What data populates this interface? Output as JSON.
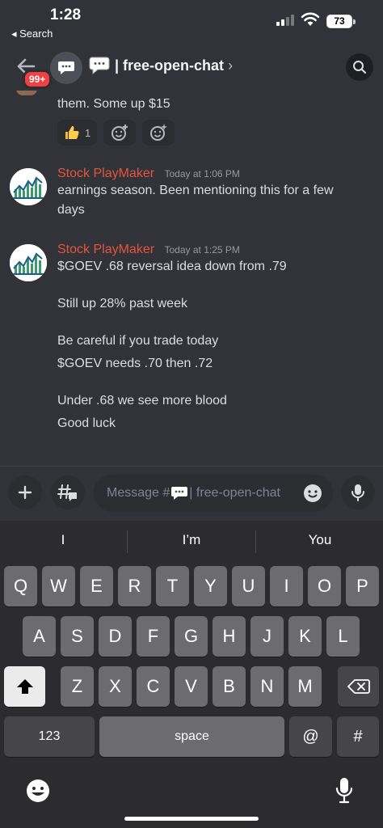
{
  "status_bar": {
    "time": "1:28",
    "back_app": "◂ Search",
    "battery": "73"
  },
  "header": {
    "badge": "99+",
    "channel_name": "| free-open-chat",
    "chevron": "›"
  },
  "messages": {
    "partial_text": "them. Some up $15",
    "reactions": [
      {
        "emoji": "thumbs-up",
        "count": "1"
      },
      {
        "emoji": "add-reaction-icon",
        "count": ""
      },
      {
        "emoji": "add-super-reaction-icon",
        "count": ""
      }
    ],
    "items": [
      {
        "author": "Stock PlayMaker",
        "timestamp": "Today at 1:06 PM",
        "lines": [
          "earnings season. Been mentioning this for a few",
          "days"
        ]
      },
      {
        "author": "Stock PlayMaker",
        "timestamp": "Today at 1:25 PM",
        "lines": [
          "$GOEV .68 reversal idea down from .79",
          "Still up 28% past week",
          "Be careful if you trade today",
          "$GOEV needs .70 then .72",
          "Under .68 we see more blood",
          "Good luck"
        ]
      }
    ]
  },
  "composer": {
    "placeholder_prefix": "Message #",
    "placeholder_suffix": " | free-open-chat"
  },
  "keyboard": {
    "suggestions": [
      "I",
      "I’m",
      "You"
    ],
    "row1": [
      "Q",
      "W",
      "E",
      "R",
      "T",
      "Y",
      "U",
      "I",
      "O",
      "P"
    ],
    "row2": [
      "A",
      "S",
      "D",
      "F",
      "G",
      "H",
      "J",
      "K",
      "L"
    ],
    "row3": [
      "Z",
      "X",
      "C",
      "V",
      "B",
      "N",
      "M"
    ],
    "numbers_label": "123",
    "space_label": "space",
    "at_label": "@",
    "hash_label": "#"
  },
  "colors": {
    "background": "#313338",
    "author": "#e5543f",
    "badge": "#f23f43"
  }
}
